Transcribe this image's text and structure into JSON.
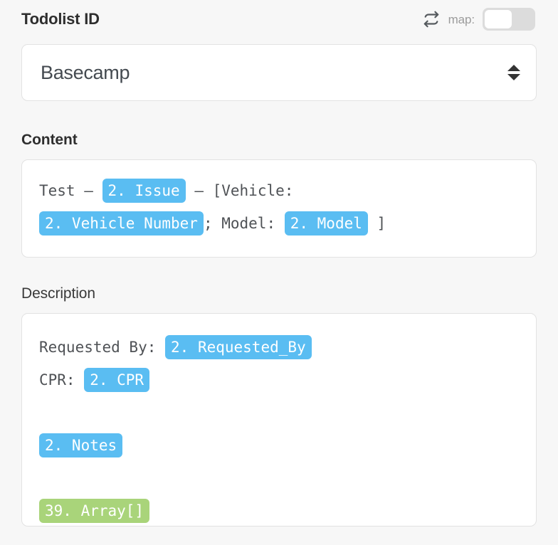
{
  "header": {
    "title": "Todolist ID",
    "repeat_icon": "repeat-icon",
    "map_label": "map:",
    "map_toggle_state": "off"
  },
  "todolist_select": {
    "value": "Basecamp",
    "stepper_icon": "stepper-updown-icon"
  },
  "content": {
    "heading": "Content",
    "lines": [
      [
        {
          "type": "text",
          "value": "Test – "
        },
        {
          "type": "token",
          "color": "blue",
          "value": "2. Issue"
        },
        {
          "type": "text",
          "value": " – [Vehicle:"
        }
      ],
      [
        {
          "type": "token",
          "color": "blue",
          "value": "2. Vehicle Number"
        },
        {
          "type": "text",
          "value": "; Model: "
        },
        {
          "type": "token",
          "color": "blue",
          "value": "2. Model"
        },
        {
          "type": "text",
          "value": " ]"
        }
      ]
    ]
  },
  "description": {
    "heading": "Description",
    "lines": [
      [
        {
          "type": "text",
          "value": "Requested By: "
        },
        {
          "type": "token",
          "color": "blue",
          "value": "2. Requested_By"
        }
      ],
      [
        {
          "type": "text",
          "value": "CPR: "
        },
        {
          "type": "token",
          "color": "blue",
          "value": "2. CPR"
        }
      ],
      [],
      [
        {
          "type": "token",
          "color": "blue",
          "value": "2. Notes"
        }
      ],
      [],
      [
        {
          "type": "token",
          "color": "green",
          "value": "39. Array[]"
        }
      ]
    ]
  },
  "colors": {
    "page_background": "#f7f7f7",
    "card_background": "#ffffff",
    "card_border": "#e2e2e2",
    "token_blue": "#5abdf2",
    "token_green": "#a9d47a",
    "heading": "#2e2e2e",
    "code_text": "#4f5256",
    "muted_text": "#9b9b9b",
    "toggle_track_off": "#dcdcdc"
  }
}
